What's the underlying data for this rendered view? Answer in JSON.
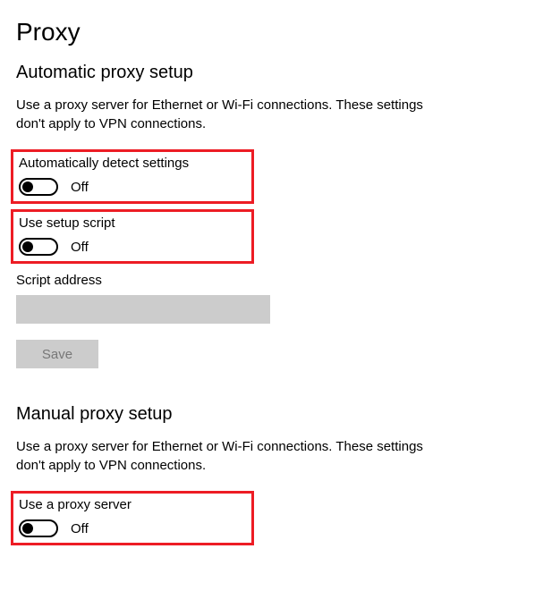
{
  "page": {
    "title": "Proxy"
  },
  "auto": {
    "heading": "Automatic proxy setup",
    "description": "Use a proxy server for Ethernet or Wi-Fi connections. These settings don't apply to VPN connections.",
    "detect": {
      "label": "Automatically detect settings",
      "state": "Off"
    },
    "script": {
      "label": "Use setup script",
      "state": "Off"
    },
    "script_address_label": "Script address",
    "script_address_value": "",
    "save_label": "Save"
  },
  "manual": {
    "heading": "Manual proxy setup",
    "description": "Use a proxy server for Ethernet or Wi-Fi connections. These settings don't apply to VPN connections.",
    "use_proxy": {
      "label": "Use a proxy server",
      "state": "Off"
    }
  }
}
